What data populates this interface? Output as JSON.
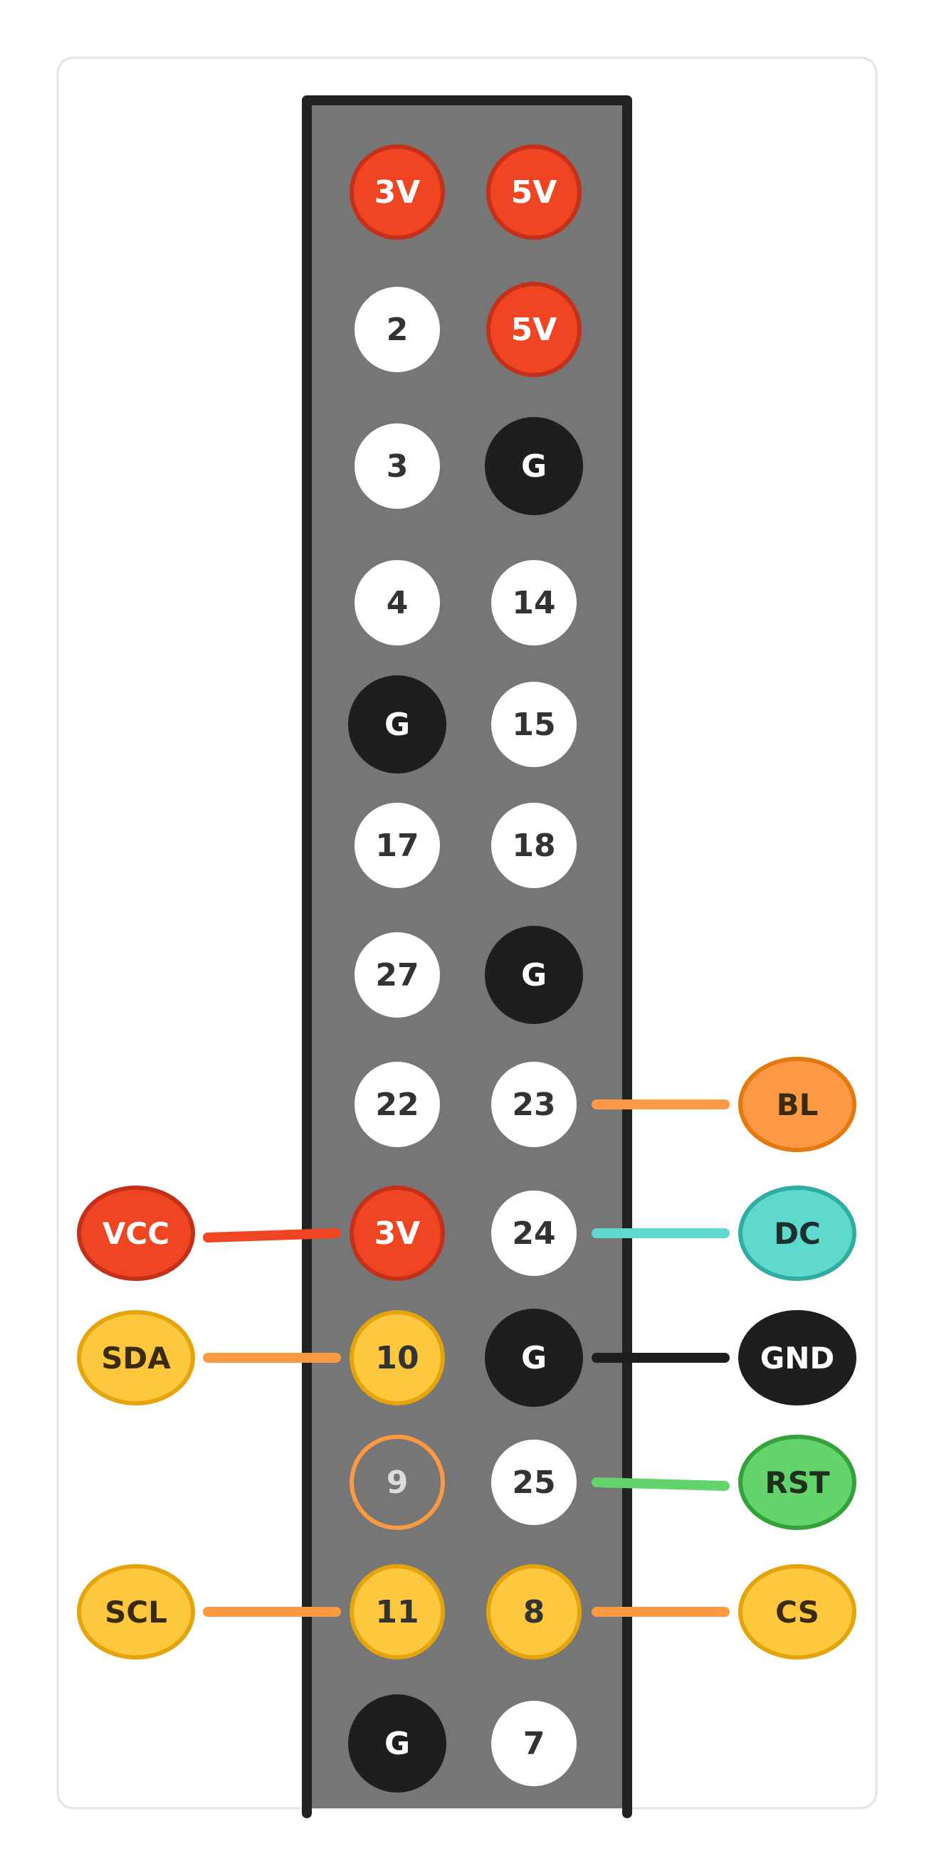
{
  "header_rows": [
    [
      {
        "label": "3V",
        "kind": "power"
      },
      {
        "label": "5V",
        "kind": "power"
      }
    ],
    [
      {
        "label": "2",
        "kind": "gpio"
      },
      {
        "label": "5V",
        "kind": "power"
      }
    ],
    [
      {
        "label": "3",
        "kind": "gpio"
      },
      {
        "label": "G",
        "kind": "ground"
      }
    ],
    [
      {
        "label": "4",
        "kind": "gpio"
      },
      {
        "label": "14",
        "kind": "gpio"
      }
    ],
    [
      {
        "label": "G",
        "kind": "ground"
      },
      {
        "label": "15",
        "kind": "gpio"
      }
    ],
    [
      {
        "label": "17",
        "kind": "gpio"
      },
      {
        "label": "18",
        "kind": "gpio"
      }
    ],
    [
      {
        "label": "27",
        "kind": "gpio"
      },
      {
        "label": "G",
        "kind": "ground"
      }
    ],
    [
      {
        "label": "22",
        "kind": "gpio"
      },
      {
        "label": "23",
        "kind": "gpio"
      }
    ],
    [
      {
        "label": "3V",
        "kind": "power"
      },
      {
        "label": "24",
        "kind": "gpio"
      }
    ],
    [
      {
        "label": "10",
        "kind": "spi"
      },
      {
        "label": "G",
        "kind": "ground"
      }
    ],
    [
      {
        "label": "9",
        "kind": "outlined"
      },
      {
        "label": "25",
        "kind": "gpio"
      }
    ],
    [
      {
        "label": "11",
        "kind": "spi"
      },
      {
        "label": "8",
        "kind": "spi"
      }
    ],
    [
      {
        "label": "G",
        "kind": "ground"
      },
      {
        "label": "7",
        "kind": "gpio"
      }
    ]
  ],
  "connections": [
    {
      "label": "BL",
      "side": "right",
      "row": 7,
      "fill": "#fb9a43",
      "stroke": "#e5780f",
      "text_color": "#3a2a10",
      "wire": "#fb9a43"
    },
    {
      "label": "VCC",
      "side": "left",
      "row": 8,
      "fill": "#ef4523",
      "stroke": "#c4301a",
      "text_color": "#ffffff",
      "wire": "#ef4523"
    },
    {
      "label": "DC",
      "side": "right",
      "row": 8,
      "fill": "#5fd9cd",
      "stroke": "#2fada2",
      "text_color": "#1e2f2e",
      "wire": "#5fd9cd"
    },
    {
      "label": "SDA",
      "side": "left",
      "row": 9,
      "fill": "#fdc83e",
      "stroke": "#e5a40c",
      "text_color": "#3a2a10",
      "wire": "#fb9a43"
    },
    {
      "label": "GND",
      "side": "right",
      "row": 9,
      "fill": "#1e1e1e",
      "stroke": "#1e1e1e",
      "text_color": "#ffffff",
      "wire": "#1e1e1e"
    },
    {
      "label": "RST",
      "side": "right",
      "row": 10,
      "fill": "#63d46b",
      "stroke": "#34a13d",
      "text_color": "#1e2f1e",
      "wire": "#63d46b"
    },
    {
      "label": "SCL",
      "side": "left",
      "row": 11,
      "fill": "#fdc83e",
      "stroke": "#e5a40c",
      "text_color": "#3a2a10",
      "wire": "#fb9a43"
    },
    {
      "label": "CS",
      "side": "right",
      "row": 11,
      "fill": "#fdc83e",
      "stroke": "#e5a40c",
      "text_color": "#3a2a10",
      "wire": "#fb9a43"
    }
  ],
  "colors": {
    "board": "#767676",
    "board_border": "#222222",
    "frame_border": "#e4e4e4",
    "power_fill": "#ef4523",
    "power_stroke": "#c4301a",
    "ground_fill": "#1e1e1e",
    "gpio_fill": "#ffffff",
    "spi_fill": "#fdc83e",
    "spi_stroke": "#e5a40c",
    "outline_stroke": "#fb9a43",
    "dark_text": "#333333",
    "light_text": "#ffffff"
  }
}
